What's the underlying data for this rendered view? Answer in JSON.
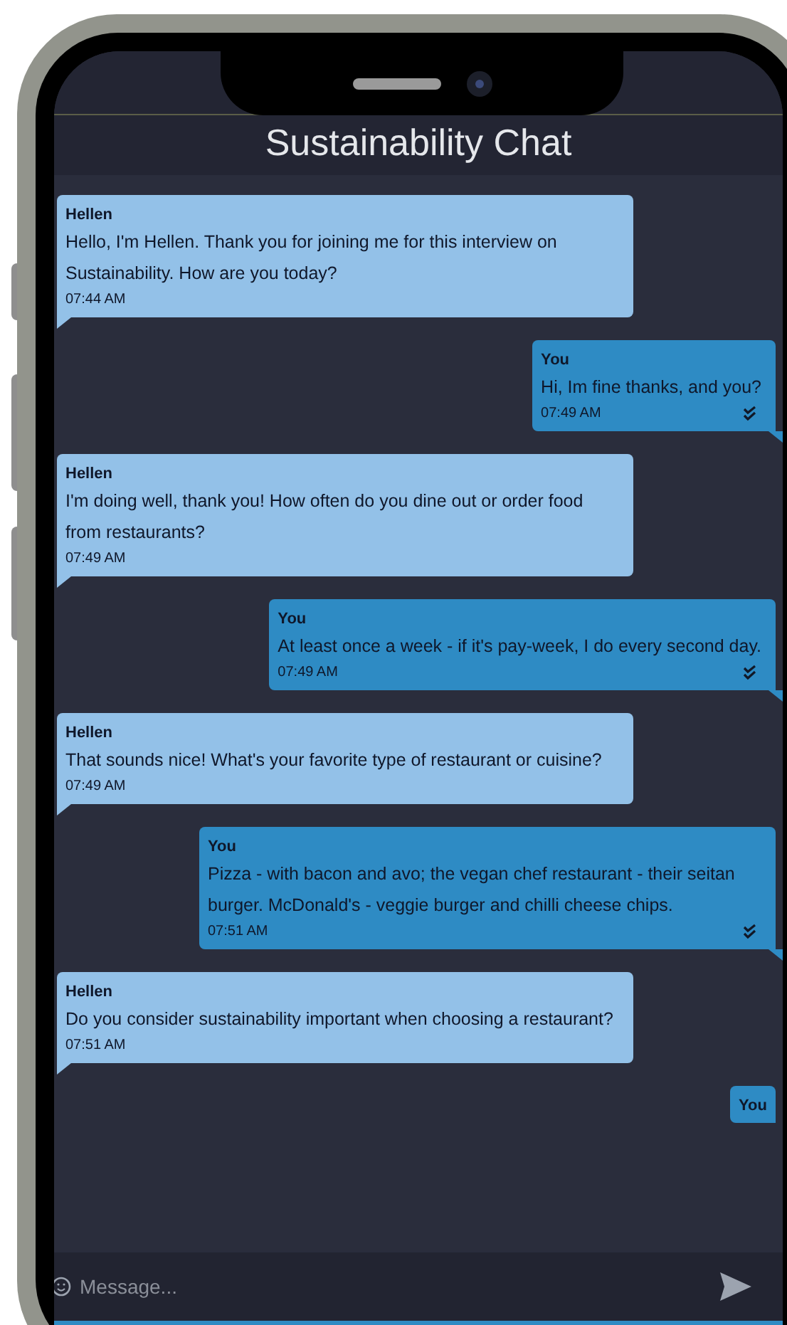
{
  "header": {
    "title": "Sustainability Chat"
  },
  "messages": [
    {
      "sender": "Hellen",
      "kind": "incoming",
      "text": "Hello, I'm Hellen. Thank you for joining me for this interview on Sustainability. How are you today?",
      "time": "07:44 AM"
    },
    {
      "sender": "You",
      "kind": "outgoing",
      "text": "Hi, Im fine thanks, and you?",
      "time": "07:49 AM",
      "read": true
    },
    {
      "sender": "Hellen",
      "kind": "incoming",
      "text": "I'm doing well, thank you! How often do you dine out or order food from restaurants?",
      "time": "07:49 AM"
    },
    {
      "sender": "You",
      "kind": "outgoing",
      "text": "At least once a week - if it's pay-week, I do every second day.",
      "time": "07:49 AM",
      "read": true
    },
    {
      "sender": "Hellen",
      "kind": "incoming",
      "text": "That sounds nice! What's your favorite type of restaurant or cuisine?",
      "time": "07:49 AM"
    },
    {
      "sender": "You",
      "kind": "outgoing",
      "text": "Pizza - with bacon and avo; the vegan chef restaurant - their seitan burger. McDonald's - veggie burger and chilli cheese chips.",
      "time": "07:51 AM",
      "read": true
    },
    {
      "sender": "Hellen",
      "kind": "incoming",
      "text": "Do you consider sustainability important when choosing a restaurant?",
      "time": "07:51 AM"
    },
    {
      "sender": "You",
      "kind": "outgoing"
    }
  ],
  "composer": {
    "placeholder": "Message..."
  }
}
